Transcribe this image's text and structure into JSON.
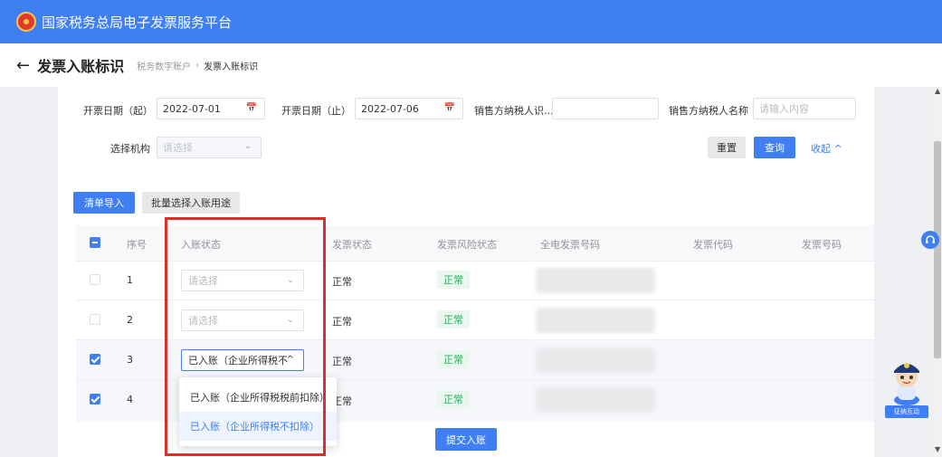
{
  "app": {
    "title": "国家税务总局电子发票服务平台"
  },
  "header": {
    "back_icon": "←",
    "page_title": "发票入账标识",
    "breadcrumb": [
      "税务数字账户",
      "发票入账标识"
    ],
    "breadcrumb_sep": "›"
  },
  "filters": {
    "date_from_label": "开票日期（起）",
    "date_from_value": "2022-07-01",
    "date_to_label": "开票日期（止）",
    "date_to_value": "2022-07-06",
    "seller_id_label": "销售方纳税人识...",
    "seller_id_value": "",
    "seller_name_label": "销售方纳税人名称",
    "seller_name_placeholder": "请输入内容",
    "org_label": "选择机构",
    "org_placeholder": "请选择",
    "reset_label": "重置",
    "query_label": "查询",
    "collapse_label": "收起",
    "collapse_icon": "^"
  },
  "actions": {
    "import_label": "清单导入",
    "batch_label": "批量选择入账用途"
  },
  "table": {
    "columns": [
      "序号",
      "入账状态",
      "发票状态",
      "发票风险状态",
      "全电发票号码",
      "发票代码",
      "发票号码"
    ],
    "rows": [
      {
        "no": "1",
        "checked": false,
        "entry_status": "请选择",
        "invoice_status": "正常",
        "risk_status": "正常"
      },
      {
        "no": "2",
        "checked": false,
        "entry_status": "请选择",
        "invoice_status": "正常",
        "risk_status": "正常"
      },
      {
        "no": "3",
        "checked": true,
        "entry_status": "已入账（企业所得税不",
        "invoice_status": "正常",
        "risk_status": "正常"
      },
      {
        "no": "4",
        "checked": true,
        "entry_status": "",
        "invoice_status": "正常",
        "risk_status": "正常"
      }
    ]
  },
  "dropdown": {
    "options": [
      "已入账（企业所得税税前扣除）",
      "已入账（企业所得税不扣除）"
    ],
    "hovered_index": 1
  },
  "submit_label": "提交入账",
  "widgets": {
    "service_icon": "headset-icon",
    "mascot_label": "征纳互动"
  },
  "colors": {
    "primary": "#3f7ff3",
    "success": "#22b05a",
    "highlight": "#d9302c"
  }
}
